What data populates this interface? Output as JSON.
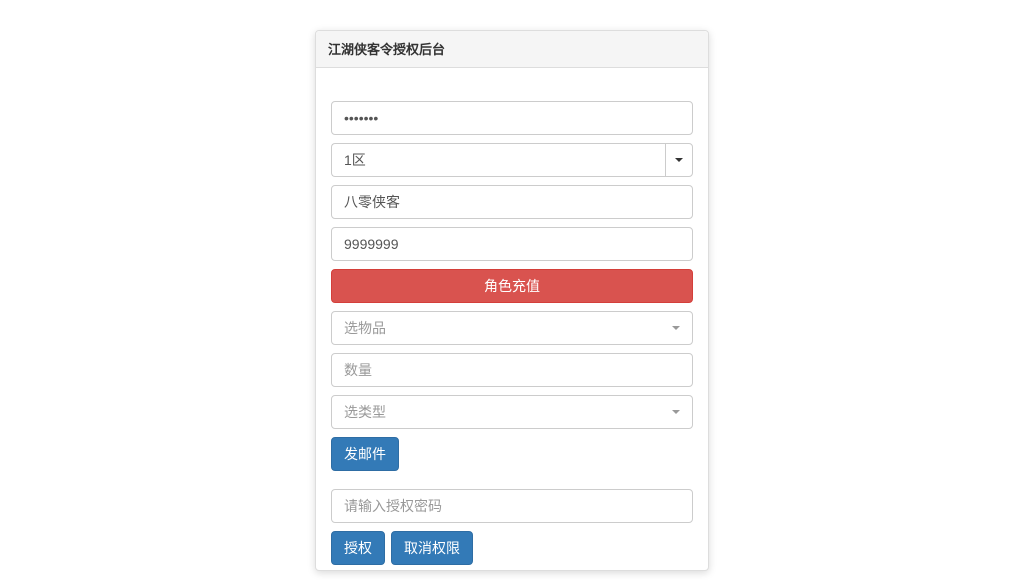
{
  "panel": {
    "title": "江湖侠客令授权后台"
  },
  "form": {
    "password_value": "•••••••",
    "region_selected": "1区",
    "name_value": "八零侠客",
    "amount_value": "9999999",
    "recharge_label": "角色充值",
    "item_select_placeholder": "选物品",
    "quantity_placeholder": "数量",
    "type_select_placeholder": "选类型",
    "send_mail_label": "发邮件",
    "auth_password_placeholder": "请输入授权密码",
    "auth_label": "授权",
    "cancel_auth_label": "取消权限"
  }
}
